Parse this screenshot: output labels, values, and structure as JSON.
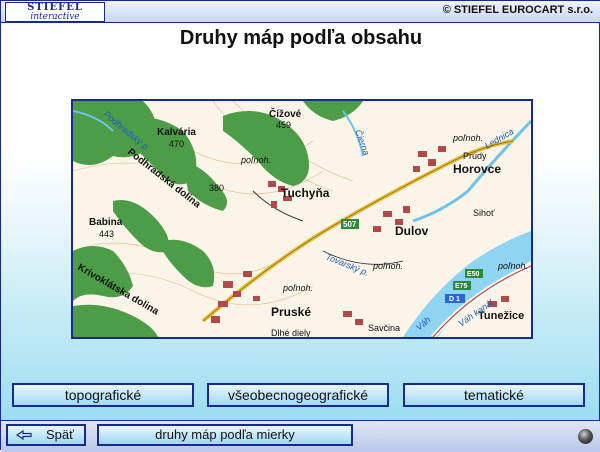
{
  "header": {
    "logo_line1": "STIEFEL",
    "logo_line2": "interactive",
    "copyright": "© STIEFEL EUROCART s.r.o."
  },
  "page": {
    "title": "Druhy máp podľa obsahu"
  },
  "map": {
    "labels": {
      "kalvaria": "Kalvária",
      "kalvaria_h": "470",
      "cizove": "Čížové",
      "cizove_h": "459",
      "podhradska": "Podhradská dolina",
      "polnoh1": "poľnoh.",
      "polnoh2": "poľnoh.",
      "polnoh3": "poľnoh.",
      "polnoh4": "poľnoh.",
      "polnoh5": "poľnoh.",
      "h380": "380",
      "tuchyna": "Tuchyňa",
      "babina": "Babina",
      "babina_h": "443",
      "krivoklatska": "Krivoklátska dolina",
      "prudy": "Prúdy",
      "horovce": "Horovce",
      "lednica": "Lednica",
      "sihot": "Sihoť",
      "dulov": "Dulov",
      "road507": "507",
      "tovarsky": "Tovarský p.",
      "prusla": "Pruské",
      "dlhe_diely": "Dlhé diely",
      "savcina": "Savčina",
      "tunezice": "Tunežice",
      "e50": "E50",
      "e75": "E75",
      "d1": "D 1",
      "vahsky_kanal": "Váh kanál",
      "vah": "Váh",
      "podhrad": "Podhradský p.",
      "vrch": "Čierna"
    }
  },
  "buttons": {
    "topo": "topografické",
    "vseo": "všeobecnogeografické",
    "tema": "tematické"
  },
  "footer": {
    "back": "Späť",
    "scale_link": "druhy máp podľa mierky"
  },
  "colors": {
    "frame": "#1a2a8a",
    "forest": "#4c9c48",
    "water": "#8fd4f2",
    "town": "#b24a4a"
  }
}
